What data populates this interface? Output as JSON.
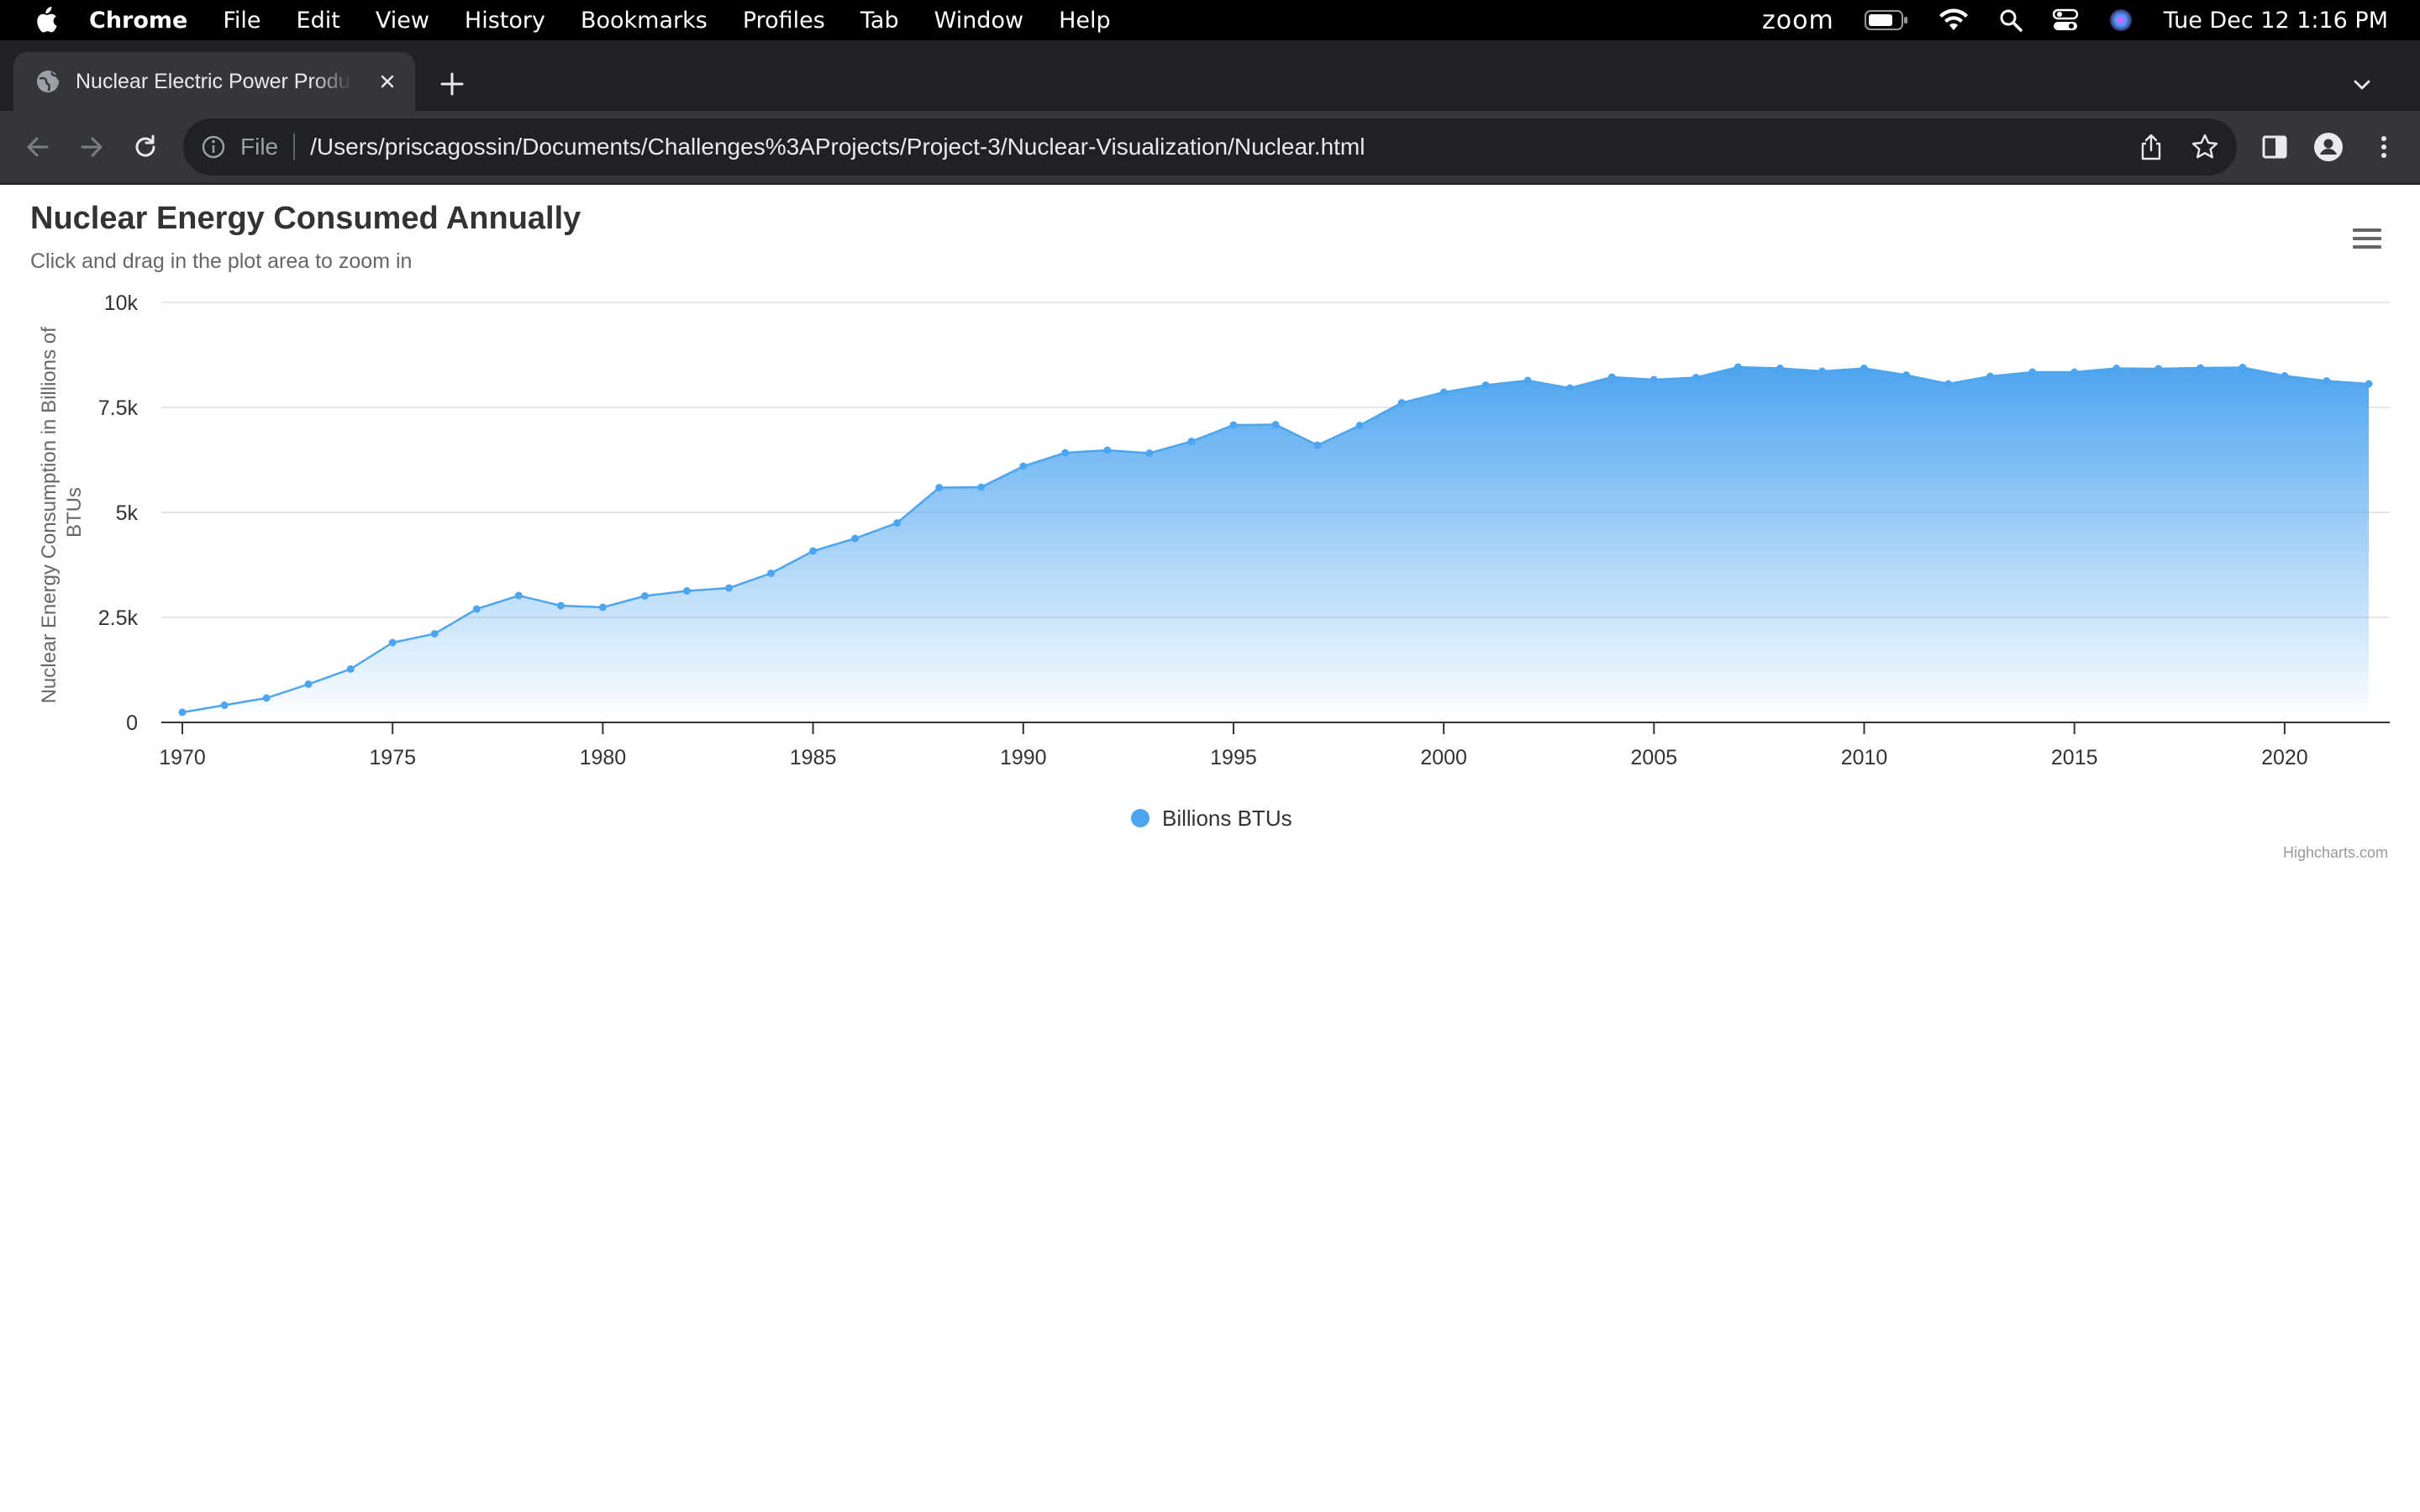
{
  "menubar": {
    "app_name": "Chrome",
    "menus": [
      "File",
      "Edit",
      "View",
      "History",
      "Bookmarks",
      "Profiles",
      "Tab",
      "Window",
      "Help"
    ],
    "zoom_label": "zoom",
    "datetime": "Tue Dec 12  1:16 PM"
  },
  "browser": {
    "tab_title": "Nuclear Electric Power Production",
    "url_scheme": "File",
    "url": "/Users/priscagossin/Documents/Challenges%3AProjects/Project-3/Nuclear-Visualization/Nuclear.html"
  },
  "colors": {
    "series": "#4ea5ef",
    "axis_text": "#333333",
    "chrome_dark": "#202124",
    "chrome_toolbar": "#35363a"
  },
  "chart_data": {
    "type": "area",
    "title": "Nuclear Energy Consumed Annually",
    "subtitle": "Click and drag in the plot area to zoom in",
    "ylabel": "Nuclear Energy Consumption in Billions of BTUs",
    "xlabel": "",
    "ylim": [
      0,
      10000
    ],
    "yticks": [
      0,
      2500,
      5000,
      7500,
      10000
    ],
    "ytick_labels": [
      "0",
      "2.5k",
      "5k",
      "7.5k",
      "10k"
    ],
    "xlim": [
      1969.5,
      2022.5
    ],
    "xticks": [
      1970,
      1975,
      1980,
      1985,
      1990,
      1995,
      2000,
      2005,
      2010,
      2015,
      2020
    ],
    "grid": true,
    "legend_position": "bottom-center",
    "credits": "Highcharts.com",
    "series": [
      {
        "name": "Billions BTUs",
        "x": [
          1970,
          1971,
          1972,
          1973,
          1974,
          1975,
          1976,
          1977,
          1978,
          1979,
          1980,
          1981,
          1982,
          1983,
          1984,
          1985,
          1986,
          1987,
          1988,
          1989,
          1990,
          1991,
          1992,
          1993,
          1994,
          1995,
          1996,
          1997,
          1998,
          1999,
          2000,
          2001,
          2002,
          2003,
          2004,
          2005,
          2006,
          2007,
          2008,
          2009,
          2010,
          2011,
          2012,
          2013,
          2014,
          2015,
          2016,
          2017,
          2018,
          2019,
          2020,
          2021,
          2022
        ],
        "values": [
          240,
          410,
          580,
          910,
          1270,
          1900,
          2110,
          2700,
          3020,
          2780,
          2740,
          3010,
          3130,
          3200,
          3550,
          4080,
          4380,
          4750,
          5590,
          5600,
          6100,
          6420,
          6480,
          6410,
          6690,
          7080,
          7090,
          6600,
          7070,
          7610,
          7860,
          8030,
          8140,
          7960,
          8220,
          8160,
          8210,
          8460,
          8430,
          8360,
          8430,
          8270,
          8060,
          8240,
          8340,
          8340,
          8430,
          8420,
          8440,
          8450,
          8250,
          8130,
          8060
        ]
      }
    ]
  }
}
